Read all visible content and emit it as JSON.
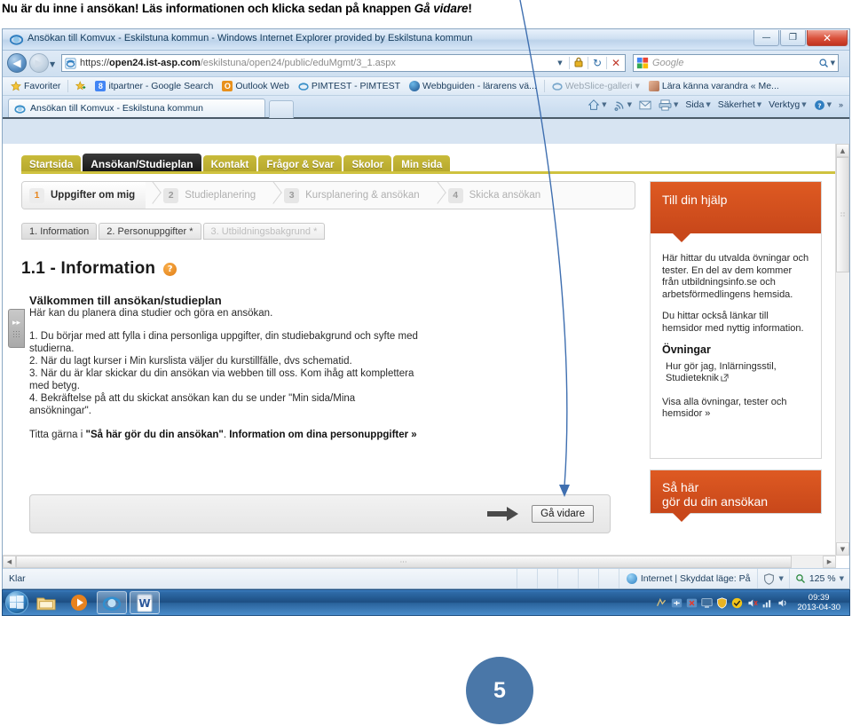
{
  "slide": {
    "heading_pre": "Nu är du inne i ansökan! Läs informationen och klicka sedan på knappen ",
    "heading_em": "Gå vidare",
    "heading_post": "!",
    "page_number": "5"
  },
  "browser": {
    "title": "Ansökan till Komvux - Eskilstuna kommun - Windows Internet Explorer provided by Eskilstuna kommun",
    "window_controls": {
      "minimize": "—",
      "maximize": "❐",
      "close": "✕"
    },
    "address": {
      "protocol": "https://",
      "domain": "open24.ist-asp.com",
      "path": "/eskilstuna/open24/public/eduMgmt/3_1.aspx",
      "full_url": "https://open24.ist-asp.com/eskilstuna/open24/public/eduMgmt/3_1.aspx"
    },
    "nav": {
      "back": "◀",
      "forward": "▶",
      "dropdown": "▼",
      "refresh": "↻",
      "stop": "✕"
    },
    "search": {
      "engine": "Google",
      "placeholder": "Google",
      "value": ""
    },
    "favorites": {
      "button": "Favoriter",
      "items": [
        {
          "label": "itpartner - Google Search",
          "icon": "google-icon",
          "dim": false
        },
        {
          "label": "Outlook Web",
          "icon": "outlook-icon",
          "dim": false
        },
        {
          "label": "PIMTEST - PIMTEST",
          "icon": "ie-icon",
          "dim": false
        },
        {
          "label": "Webbguiden - lärarens vä...",
          "icon": "globe-icon",
          "dim": false
        },
        {
          "label": "WebSlice-galleri",
          "icon": "ie-icon",
          "dim": true
        },
        {
          "label": "Lära känna varandra « Me...",
          "icon": "photo-icon",
          "dim": false
        }
      ]
    },
    "tab": {
      "label": "Ansökan till Komvux - Eskilstuna kommun"
    },
    "command_bar": [
      {
        "label": "",
        "icon": "home-icon",
        "caret": true
      },
      {
        "label": "",
        "icon": "feeds-icon",
        "caret": true
      },
      {
        "label": "",
        "icon": "mail-icon",
        "caret": false
      },
      {
        "label": "",
        "icon": "print-icon",
        "caret": true
      },
      {
        "label": "Sida",
        "icon": "",
        "caret": true
      },
      {
        "label": "Säkerhet",
        "icon": "",
        "caret": true
      },
      {
        "label": "Verktyg",
        "icon": "",
        "caret": true
      },
      {
        "label": "",
        "icon": "help-icon",
        "caret": true
      },
      {
        "label": "»",
        "icon": "",
        "caret": false
      }
    ],
    "status": {
      "text": "Klar",
      "zone": "Internet | Skyddat läge: På",
      "zoom": "125 %"
    }
  },
  "site": {
    "nav": [
      {
        "label": "Startsida",
        "active": false
      },
      {
        "label": "Ansökan/Studieplan",
        "active": true
      },
      {
        "label": "Kontakt",
        "active": false
      },
      {
        "label": "Frågor & Svar",
        "active": false
      },
      {
        "label": "Skolor",
        "active": false
      },
      {
        "label": "Min sida",
        "active": false
      }
    ],
    "wizard": [
      {
        "num": "1",
        "label": "Uppgifter om mig",
        "active": true
      },
      {
        "num": "2",
        "label": "Studieplanering",
        "active": false
      },
      {
        "num": "3",
        "label": "Kursplanering & ansökan",
        "active": false
      },
      {
        "num": "4",
        "label": "Skicka ansökan",
        "active": false
      }
    ],
    "subtabs": [
      {
        "label": "1. Information",
        "state": "active"
      },
      {
        "label": "2. Personuppgifter *",
        "state": "normal"
      },
      {
        "label": "3. Utbildningsbakgrund *",
        "state": "disabled"
      }
    ],
    "page_title": "1.1 - Information",
    "help_icon_glyph": "?",
    "content": {
      "welcome_heading": "Välkommen till ansökan/studieplan",
      "welcome_sub": "Här kan du planera dina studier och göra en ansökan.",
      "steps": [
        "1. Du börjar med att fylla i dina personliga uppgifter, din studiebakgrund och syfte med studierna.",
        "2. När du lagt kurser i Min kurslista väljer du kurstillfälle, dvs schematid.",
        "3. När du är klar skickar du din ansökan via webben till oss. Kom ihåg att komplettera med betyg.",
        "4. Bekräftelse på att du skickat ansökan kan du se under \"Min sida/Mina ansökningar\"."
      ],
      "footer_plain": "Titta gärna i ",
      "footer_bold1": "\"Så här gör du din ansökan\"",
      "footer_plain2": ".  ",
      "footer_bold2": "Information om dina personuppgifter »"
    },
    "next_button": {
      "label": "Gå vidare",
      "arrow_icon": "arrow-right-icon"
    },
    "sidebar": {
      "help_panel": {
        "title": "Till din hjälp",
        "paragraphs": [
          "Här hittar du utvalda övningar och tester. En del av dem kommer från utbildningsinfo.se och arbetsförmedlingens hemsida.",
          "Du hittar också länkar till hemsidor med nyttig information."
        ],
        "section_heading": "Övningar",
        "section_link": "Hur gör jag, Inlärningsstil, Studieteknik",
        "all_link": "Visa alla övningar, tester och hemsidor »"
      },
      "howto_panel": {
        "line1": "Så här",
        "line2": "gör du din ansökan"
      }
    }
  },
  "taskbar": {
    "start": "start-orb",
    "items": [
      {
        "name": "explorer-icon",
        "active": false
      },
      {
        "name": "media-player-icon",
        "active": false
      },
      {
        "name": "internet-explorer-icon",
        "active": true
      },
      {
        "name": "word-icon",
        "active": true
      }
    ],
    "clock": {
      "time": "09:39",
      "date": "2013-04-30"
    }
  },
  "colors": {
    "brand_orange": "#d2511d",
    "nav_yellow": "#c9bb3a",
    "accent_blue": "#4a77a8",
    "annotation_arrow": "#3f6fb0"
  }
}
